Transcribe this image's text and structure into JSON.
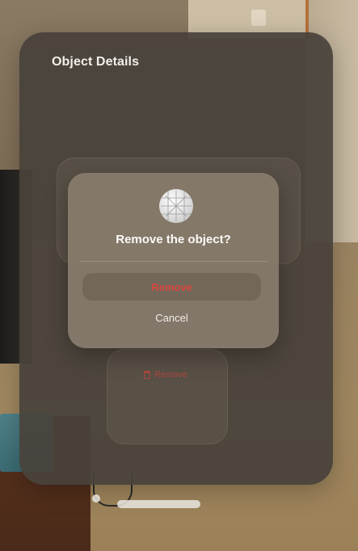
{
  "window": {
    "title": "Object Details"
  },
  "alert": {
    "icon": "globe-icon",
    "title": "Remove the object?",
    "remove_label": "Remove",
    "cancel_label": "Cancel"
  },
  "background_action": {
    "icon": "trash-icon",
    "label": "Remove"
  },
  "colors": {
    "destructive": "#d9463f",
    "text": "#fbfaf8"
  }
}
